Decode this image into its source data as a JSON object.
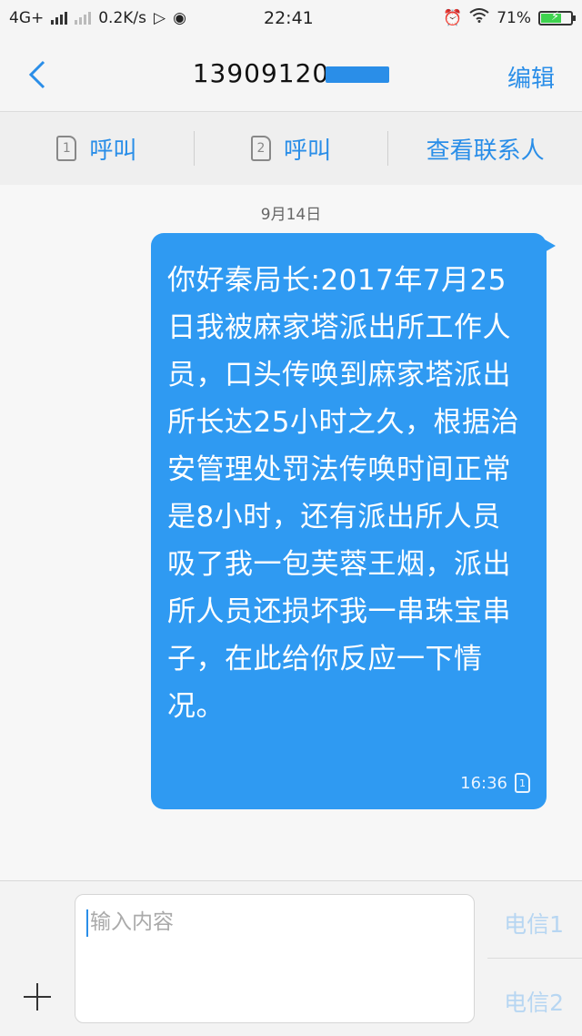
{
  "status": {
    "network": "4G+",
    "speed": "0.2K/s",
    "time": "22:41",
    "battery": "71%",
    "battery_level": 0.71
  },
  "header": {
    "title": "13909120",
    "edit_label": "编辑"
  },
  "actions": {
    "call1_sim": "1",
    "call1_label": "呼叫",
    "call2_sim": "2",
    "call2_label": "呼叫",
    "contact_label": "查看联系人"
  },
  "conversation": {
    "date": "9月14日",
    "message": "你好秦局长:2017年7月25日我被麻家塔派出所工作人员，口头传唤到麻家塔派出所长达25小时之久，根据治安管理处罚法传唤时间正常是8小时，还有派出所人员吸了我一包芙蓉王烟，派出所人员还损坏我一串珠宝串子，在此给你反应一下情况。",
    "message_time": "16:36",
    "message_sim": "1"
  },
  "composer": {
    "placeholder": "输入内容",
    "send1_label": "电信1",
    "send2_label": "电信2"
  },
  "colors": {
    "accent": "#2a8ee8",
    "bubble": "#2f9af2"
  }
}
